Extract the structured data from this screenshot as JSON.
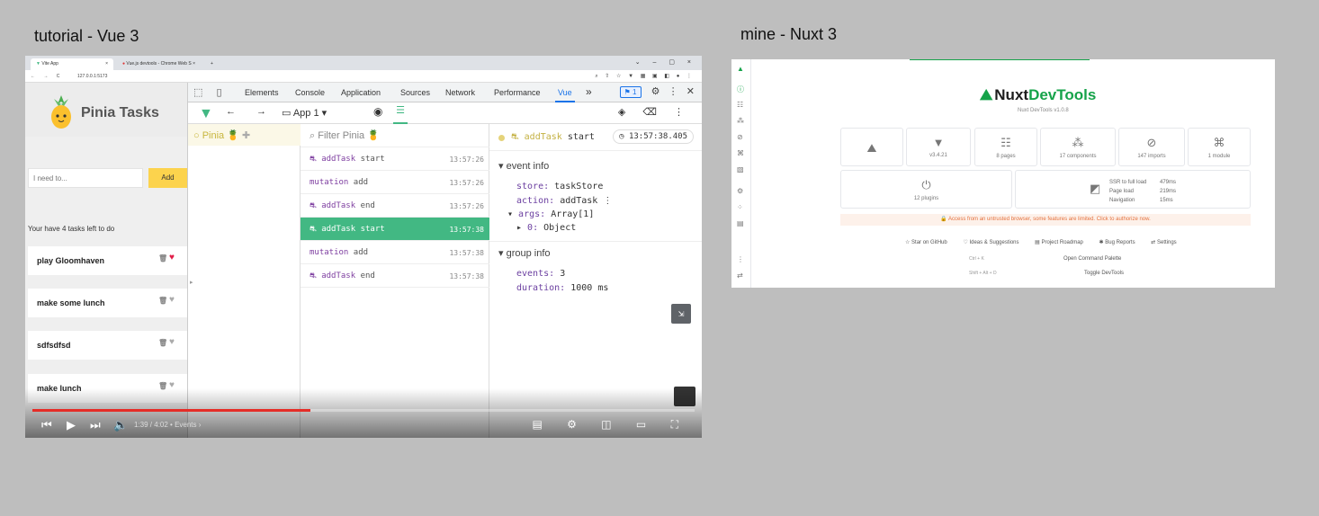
{
  "captions": {
    "left": "tutorial - Vue 3",
    "right": "mine - Nuxt 3"
  },
  "browser": {
    "tabs": [
      "Vite App",
      "Vue.js devtools - Chrome Web S"
    ],
    "url": "127.0.0.1:5173"
  },
  "app": {
    "title": "Pinia Tasks",
    "input_placeholder": "I need to...",
    "add_label": "Add",
    "tasks_left": "Your have 4 tasks left to do",
    "tasks": [
      {
        "label": "play Gloomhaven",
        "fav": true
      },
      {
        "label": "make some lunch",
        "fav": false
      },
      {
        "label": "sdfsdfsd",
        "fav": false
      },
      {
        "label": "make lunch",
        "fav": false
      }
    ]
  },
  "devtools": {
    "tabs": [
      "Elements",
      "Console",
      "Application",
      "Sources",
      "Network",
      "Performance",
      "Vue"
    ],
    "badge": "1",
    "app_select": "App 1",
    "layer": "Pinia",
    "filter_placeholder": "Filter Pinia",
    "events": [
      {
        "label": "addTask",
        "rest": "start",
        "time": "13:57:26",
        "selected": false
      },
      {
        "label": "mutation",
        "rest": "add",
        "time": "13:57:26",
        "selected": false
      },
      {
        "label": "addTask",
        "rest": "end",
        "time": "13:57:26",
        "selected": false
      },
      {
        "label": "addTask",
        "rest": "start",
        "time": "13:57:38",
        "selected": true
      },
      {
        "label": "mutation",
        "rest": "add",
        "time": "13:57:38",
        "selected": false
      },
      {
        "label": "addTask",
        "rest": "end",
        "time": "13:57:38",
        "selected": false
      }
    ],
    "detail": {
      "name": "addTask",
      "rest": "start",
      "timestamp": "13:57:38.405",
      "event_info_title": "event info",
      "store_key": "store:",
      "store_val": "taskStore",
      "action_key": "action:",
      "action_val": "addTask",
      "args_key": "args:",
      "args_val": "Array[1]",
      "arg0_key": "0:",
      "arg0_val": "Object",
      "group_info_title": "group info",
      "events_key": "events:",
      "events_val": "3",
      "duration_key": "duration:",
      "duration_val": "1000 ms"
    }
  },
  "player": {
    "time": "1:39 / 4:02",
    "chapter": "• Events",
    "progress": 0.42
  },
  "nuxt": {
    "brand_a": "Nuxt",
    "brand_b": "DevTools",
    "version": "Nuxt DevTools v1.0.8",
    "cards": [
      {
        "icon": "nuxt-icon",
        "label": ""
      },
      {
        "icon": "vue-icon",
        "label": "v3.4.21"
      },
      {
        "icon": "pages-icon",
        "label": "8 pages"
      },
      {
        "icon": "components-icon",
        "label": "17 components"
      },
      {
        "icon": "imports-icon",
        "label": "147 imports"
      },
      {
        "icon": "module-icon",
        "label": "1 module"
      }
    ],
    "plugins": "12 plugins",
    "stats": [
      {
        "label": "SSR to full load",
        "value": "479ms"
      },
      {
        "label": "Page load",
        "value": "219ms"
      },
      {
        "label": "Navigation",
        "value": "15ms"
      }
    ],
    "warning": "Access from an untrusted browser, some features are limited. Click to authorize now.",
    "links": [
      "Star on GitHub",
      "Ideas & Suggestions",
      "Project Roadmap",
      "Bug Reports",
      "Settings"
    ],
    "shortcut1_keys": "Ctrl  +  K",
    "shortcut1_label": "Open Command Palette",
    "shortcut2_keys": "Shift  +  Alt  +  D",
    "shortcut2_label": "Toggle DevTools"
  }
}
